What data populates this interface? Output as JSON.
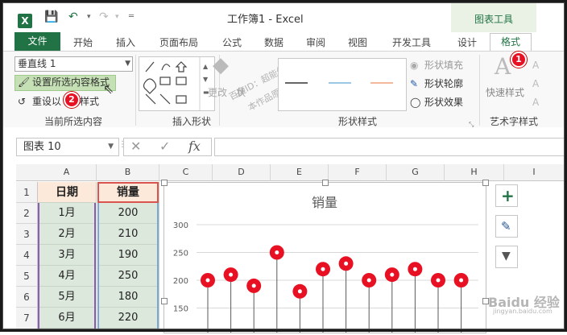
{
  "titlebar": {
    "title": "工作簿1 - Excel",
    "contextual_label": "图表工具",
    "excel_letter": "X"
  },
  "tabs": [
    {
      "label": "文件"
    },
    {
      "label": "开始"
    },
    {
      "label": "插入"
    },
    {
      "label": "页面布局"
    },
    {
      "label": "公式"
    },
    {
      "label": "数据"
    },
    {
      "label": "审阅"
    },
    {
      "label": "视图"
    },
    {
      "label": "开发工具"
    },
    {
      "label": "设计"
    },
    {
      "label": "格式"
    }
  ],
  "ribbon": {
    "selection_combo_value": "垂直线 1",
    "format_selection_label": "设置所选内容格式",
    "reset_label_left": "重设以",
    "reset_label_right": "样式",
    "group_current": "当前所选内容",
    "group_insert_shapes": "插入形状",
    "group_shape_styles": "形状样式",
    "group_wordart": "艺术字样式",
    "change_shape_label_left": "更改",
    "change_shape_label_right": "状",
    "shape_fill": "形状填充",
    "shape_outline": "形状轮廓",
    "shape_effects": "形状效果",
    "quick_styles": "快速样式",
    "badge1": "1",
    "badge2": "2",
    "watermark1": "百度ID：超能仔仔",
    "watermark2": "本作品原创作者"
  },
  "formula_bar": {
    "name_box": "图表 10",
    "fx": "fx",
    "cancel": "✕",
    "enter": "✓"
  },
  "columns": [
    "A",
    "B",
    "C",
    "D",
    "E",
    "F",
    "G",
    "H",
    "I"
  ],
  "rows": [
    "1",
    "2",
    "3",
    "4",
    "5",
    "6",
    "7"
  ],
  "table": {
    "headers": [
      "日期",
      "销量"
    ],
    "data": [
      [
        "1月",
        "200"
      ],
      [
        "2月",
        "210"
      ],
      [
        "3月",
        "190"
      ],
      [
        "4月",
        "250"
      ],
      [
        "5月",
        "180"
      ],
      [
        "6月",
        "220"
      ]
    ]
  },
  "chart_data": {
    "type": "scatter",
    "title": "销量",
    "yticks": [
      "300",
      "250",
      "200",
      "150"
    ],
    "ylim": [
      150,
      300
    ],
    "values": [
      200,
      210,
      190,
      250,
      180,
      220,
      230,
      200,
      210,
      220,
      200,
      200
    ],
    "marker_color": "#e81123",
    "grid": true,
    "drop_lines": true
  },
  "side_buttons": [
    "+",
    "✎",
    "▼"
  ],
  "watermark_corner": "Baidu 经验",
  "watermark_corner_sub": "jingyan.baidu.com",
  "colors": {
    "excel_green": "#217346",
    "accent_red": "#e81123"
  }
}
